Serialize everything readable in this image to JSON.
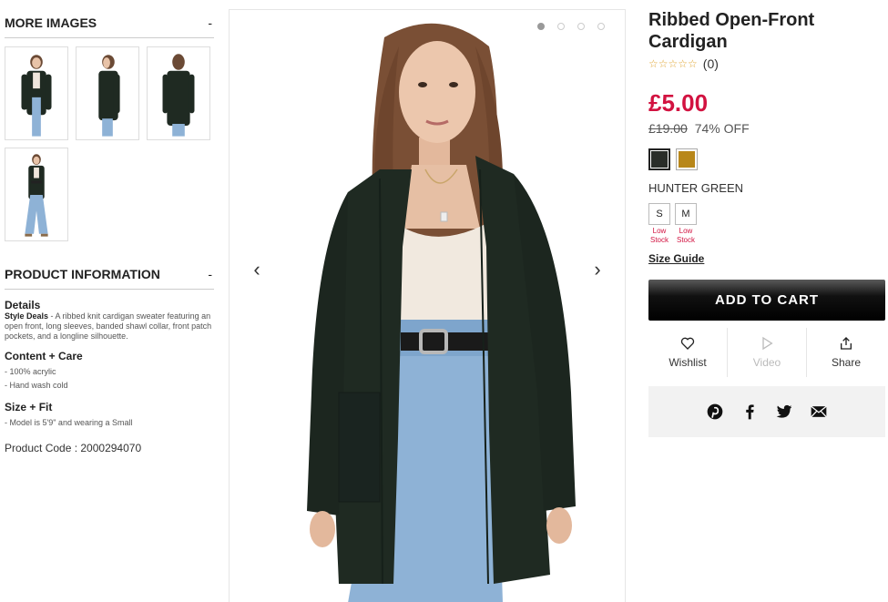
{
  "more_images": {
    "title": "MORE IMAGES",
    "toggle": "-",
    "thumbnails": [
      "front view",
      "side view",
      "back view",
      "full length view"
    ]
  },
  "product_info": {
    "title": "PRODUCT INFORMATION",
    "toggle": "-",
    "details_title": "Details",
    "details_label": "Style Deals",
    "details_text": " - A ribbed knit cardigan sweater featuring an open front, long sleeves, banded shawl collar, front patch pockets, and a longline silhouette.",
    "content_title": "Content + Care",
    "content_items": [
      "- 100% acrylic",
      "- Hand wash cold"
    ],
    "size_fit_title": "Size + Fit",
    "size_fit_items": [
      "- Model is 5'9\" and wearing a Small"
    ],
    "product_code": "Product Code : 2000294070"
  },
  "gallery": {
    "prev": "‹",
    "next": "›",
    "dots": 4,
    "active_dot": 0
  },
  "product": {
    "title": "Ribbed Open-Front Cardigan",
    "stars": "☆☆☆☆☆",
    "review_count": "(0)",
    "price": "£5.00",
    "original_price": "£19.00",
    "discount": "74% OFF",
    "color_name": "HUNTER GREEN",
    "swatches": [
      {
        "name": "hunter-green",
        "color": "#2a2d29",
        "selected": true
      },
      {
        "name": "mustard",
        "color": "#b8871a",
        "selected": false
      }
    ],
    "sizes": [
      {
        "label": "S",
        "stock": "Low Stock"
      },
      {
        "label": "M",
        "stock": "Low Stock"
      }
    ],
    "size_guide": "Size Guide",
    "add_to_cart": "ADD TO CART",
    "actions": {
      "wishlist": "Wishlist",
      "video": "Video",
      "share": "Share"
    }
  },
  "colors": {
    "price_red": "#d21240",
    "cardigan": "#1f2a22",
    "denim": "#8eb2d6"
  }
}
